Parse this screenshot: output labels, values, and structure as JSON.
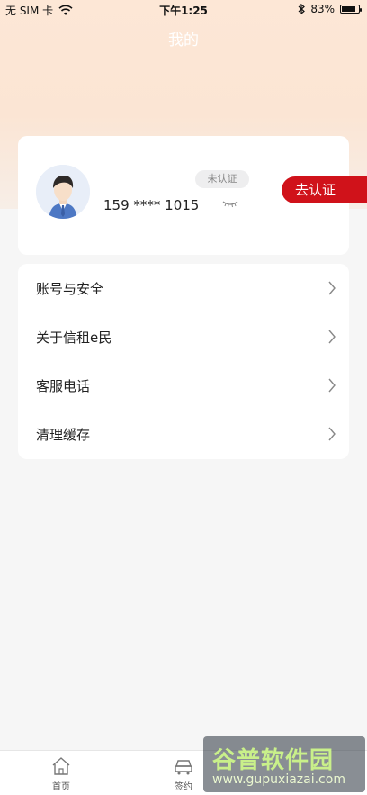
{
  "status_bar": {
    "carrier": "无 SIM 卡",
    "time": "下午1:25",
    "battery": "83%",
    "battery_level": 0.83
  },
  "header": {
    "title": "我的"
  },
  "profile": {
    "badge": "未认证",
    "phone": "159 **** 1015",
    "verify_button": "去认证"
  },
  "menu": {
    "items": [
      {
        "label": "账号与安全"
      },
      {
        "label": "关于信租e民"
      },
      {
        "label": "客服电话"
      },
      {
        "label": "清理缓存"
      }
    ]
  },
  "tabbar": {
    "items": [
      {
        "label": "首页",
        "icon": "home-icon"
      },
      {
        "label": "签约",
        "icon": "car-icon"
      }
    ]
  },
  "watermark": {
    "title": "谷普软件园",
    "url": "www.gupuxiazai.com"
  },
  "colors": {
    "accent": "#d0121a",
    "hero_top": "#fde7d6",
    "background": "#f6f6f6"
  }
}
